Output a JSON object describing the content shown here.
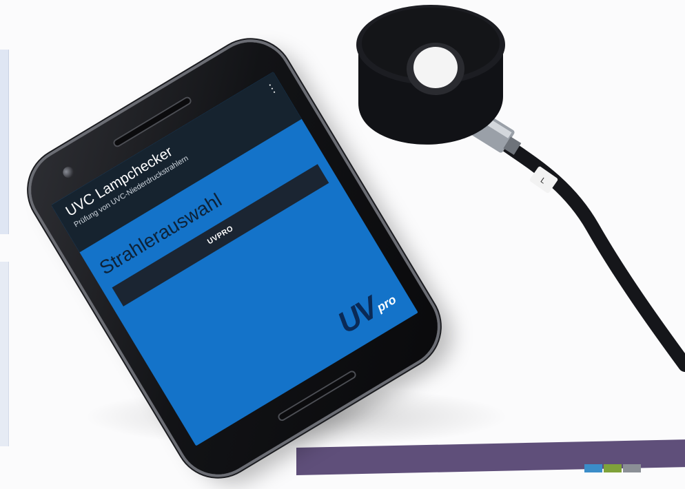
{
  "app": {
    "title": "UVC Lampchecker",
    "subtitle": "Prüfung von UVC-Niederdruckstrahlern",
    "menu_icon": "more-vert-icon",
    "section_heading": "Strahlerauswahl",
    "device_button_label": "UVPRO"
  },
  "branding": {
    "logo_uv": "UV",
    "logo_pro": "pro"
  },
  "sensor": {
    "cable_label": "L"
  },
  "colors": {
    "screen_blue": "#1473c9",
    "app_bar": "#16232f",
    "button": "#1b2532",
    "brand_dark": "#0a2a56",
    "bottom_bar": "#5f4f7a"
  }
}
